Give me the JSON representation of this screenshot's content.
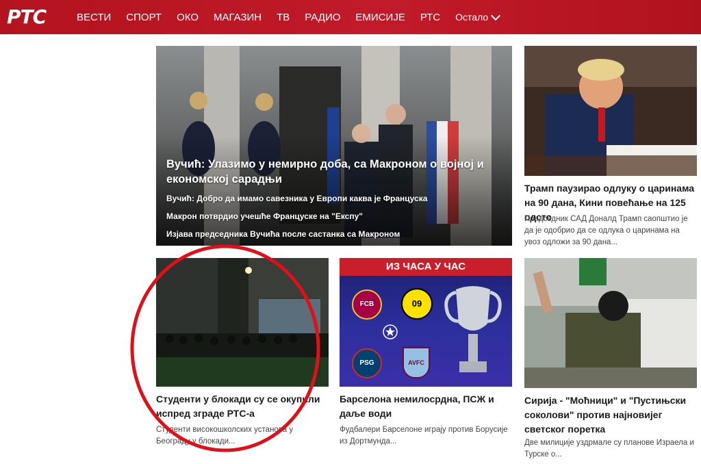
{
  "logo": "РТС",
  "nav": {
    "items": [
      "ВЕСТИ",
      "СПОРТ",
      "ОКО",
      "МАГАЗИН",
      "ТВ",
      "РАДИО",
      "ЕМИСИЈЕ",
      "РТС"
    ],
    "more": "Остало"
  },
  "hero": {
    "title": "Вучић: Улазимо у немирно доба, са Макроном о војној и економској сарадњи",
    "links": [
      "Вучић: Добро да имамо савезника у Европи каква је Француска",
      "Макрон потврдио учешће Француске на \"Експу\"",
      "Изјава председника Вучића после састанка са Макроном"
    ]
  },
  "cards": [
    {
      "title": "Трамп паузирао одлуку о царинама на 90 дана, Кини повећање на 125 одсто",
      "desc": "Председник САД Доналд Трамп саопштио је да је одобрио да се одлука о царинама на увоз одложи за 90 дана..."
    },
    {
      "title": "Студенти у блокади су се окупили испред зграде РТС-а",
      "desc": "Студенти високошколских установа у Београду у блокади..."
    },
    {
      "title": "Барселона немилосрдна, ПСЖ и даље води",
      "desc": "Фудбалери Барселоне играју против Борусије из Дортмунда...",
      "banner": "ИЗ ЧАСА У ЧАС",
      "badges": [
        "FCB",
        "09",
        "PSG",
        "AVFC"
      ]
    },
    {
      "title": "Сирија - \"Моћници\" и \"Пустињски соколови\" против најновијег светског поретка",
      "desc": "Две милиције уздрмале су планове Израела и Турске о..."
    }
  ],
  "colors": {
    "brand": "#c21a2a",
    "annotation": "#e0101a"
  }
}
